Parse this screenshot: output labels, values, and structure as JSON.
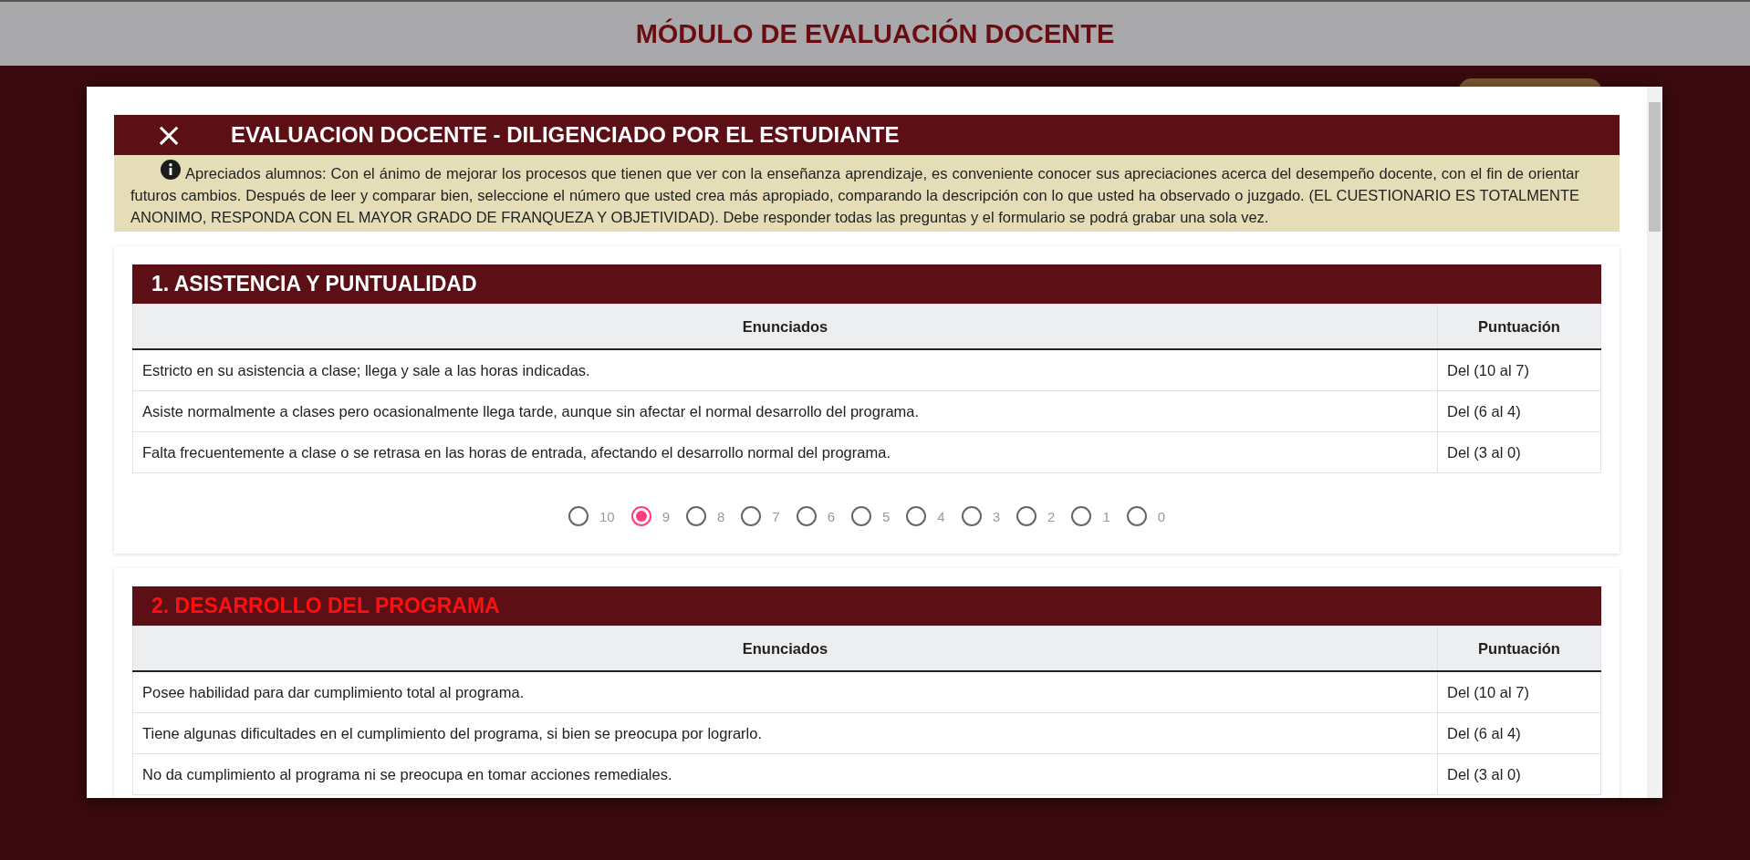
{
  "page_title": "MÓDULO DE EVALUACIÓN DOCENTE",
  "dialog": {
    "title": "EVALUACION DOCENTE - DILIGENCIADO POR EL ESTUDIANTE",
    "close": "×",
    "notice": "Apreciados alumnos: Con el ánimo de mejorar los procesos que tienen que ver con la enseñanza aprendizaje, es conveniente conocer sus apreciaciones acerca del desempeño docente, con el fin de orientar futuros cambios. Después de leer y comparar bien, seleccione el número que usted crea más apropiado, comparando la descripción con lo que usted ha observado o juzgado. (EL CUESTIONARIO ES TOTALMENTE ANONIMO, RESPONDA CON EL MAYOR GRADO DE FRANQUEZA Y OBJETIVIDAD). Debe responder todas las preguntas y el formulario se podrá grabar una sola vez."
  },
  "sections": [
    {
      "title": "1. ASISTENCIA Y PUNTUALIDAD",
      "unanswered": false,
      "columns": [
        "Enunciados",
        "Puntuación"
      ],
      "rows": [
        [
          "Estricto en su asistencia a clase; llega y sale a las horas indicadas.",
          "Del (10 al 7)"
        ],
        [
          "Asiste normalmente a clases pero ocasionalmente llega tarde, aunque sin afectar el normal desarrollo del programa.",
          "Del (6 al 4)"
        ],
        [
          "Falta frecuentemente a clase o se retrasa en las horas de entrada, afectando el desarrollo normal del programa.",
          "Del (3 al 0)"
        ]
      ],
      "options": [
        {
          "label": "10",
          "selected": false
        },
        {
          "label": "9",
          "selected": true
        },
        {
          "label": "8",
          "selected": false
        },
        {
          "label": "7",
          "selected": false
        },
        {
          "label": "6",
          "selected": false
        },
        {
          "label": "5",
          "selected": false
        },
        {
          "label": "4",
          "selected": false
        },
        {
          "label": "3",
          "selected": false
        },
        {
          "label": "2",
          "selected": false
        },
        {
          "label": "1",
          "selected": false
        },
        {
          "label": "0",
          "selected": false
        }
      ]
    },
    {
      "title": "2. DESARROLLO DEL PROGRAMA",
      "unanswered": true,
      "columns": [
        "Enunciados",
        "Puntuación"
      ],
      "rows": [
        [
          "Posee habilidad para dar cumplimiento total al programa.",
          "Del (10 al 7)"
        ],
        [
          "Tiene algunas dificultades en el cumplimiento del programa, si bien se preocupa por lograrlo.",
          "Del (6 al 4)"
        ],
        [
          "No da cumplimiento al programa ni se preocupa en tomar acciones remediales.",
          "Del (3 al 0)"
        ]
      ]
    }
  ]
}
